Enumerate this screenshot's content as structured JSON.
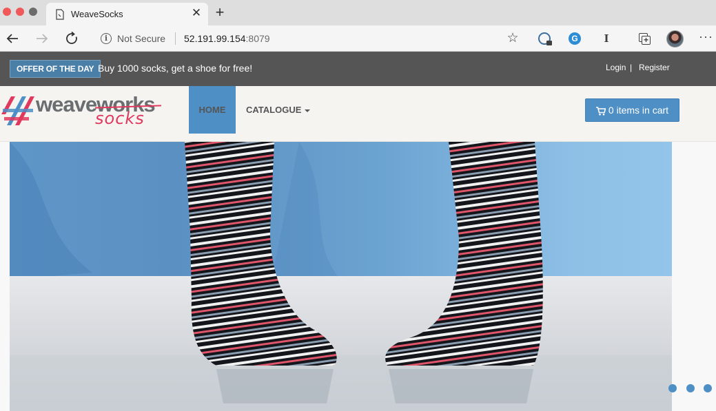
{
  "browser": {
    "tab_title": "WeaveSocks",
    "close_glyph": "✕",
    "new_tab_glyph": "+",
    "security_label": "Not Secure",
    "url_host": "52.191.99.154",
    "url_port": ":8079",
    "icons": [
      "back-arrow-icon",
      "forward-arrow-icon",
      "reload-icon",
      "info-icon",
      "star-icon",
      "shield-extension-icon",
      "grammarly-extension-icon",
      "instapaper-extension-icon",
      "collections-icon",
      "avatar",
      "more-icon"
    ]
  },
  "offer": {
    "badge": "OFFER OF THE DAY",
    "text": "Buy 1000 socks, get a shoe for free!",
    "login": "Login",
    "separator": "|",
    "register": "Register"
  },
  "header": {
    "logo_weave": "weaveworks",
    "logo_socks": "socks",
    "nav_home": "HOME",
    "nav_catalogue": "CATALOGUE",
    "cart_label": "0 items in cart"
  },
  "carousel": {
    "slide_count": 3
  },
  "colors": {
    "accent_blue": "#4e8fc5",
    "offer_bar": "#555555",
    "brand_pink": "#e0395d",
    "header_bg": "#f5f4f1"
  }
}
